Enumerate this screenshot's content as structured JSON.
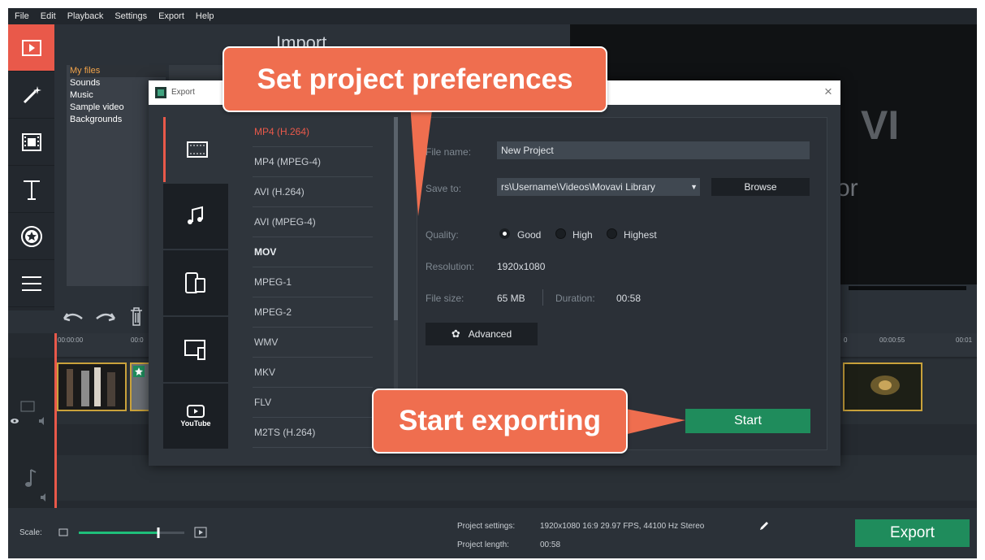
{
  "menu": [
    "File",
    "Edit",
    "Playback",
    "Settings",
    "Export",
    "Help"
  ],
  "import": {
    "title": "Import",
    "categories": [
      "My files",
      "Sounds",
      "Music",
      "Sample video",
      "Backgrounds"
    ],
    "selected": "My files"
  },
  "rail_icons": [
    "import-icon",
    "magic-wand-icon",
    "film-icon",
    "text-icon",
    "sticker-icon",
    "menu-icon"
  ],
  "timeline": {
    "ruler_labels": [
      "00:00:00",
      "00:0",
      "0",
      "00:00:55",
      "00:01"
    ]
  },
  "bottom": {
    "scale_label": "Scale:",
    "scale_value": 0.75,
    "project_settings_label": "Project settings:",
    "project_settings_value": "1920x1080 16:9 29.97 FPS, 44100 Hz Stereo",
    "project_length_label": "Project length:",
    "project_length_value": "00:58",
    "export_label": "Export"
  },
  "dialog": {
    "title": "Export",
    "close": "×",
    "tab_youtube_label": "YouTube",
    "formats": [
      "MP4 (H.264)",
      "MP4 (MPEG-4)",
      "AVI (H.264)",
      "AVI (MPEG-4)",
      "MOV",
      "MPEG-1",
      "MPEG-2",
      "WMV",
      "MKV",
      "FLV",
      "M2TS (H.264)"
    ],
    "selected_format": "MP4 (H.264)",
    "file_name_label": "File name:",
    "file_name_value": "New Project",
    "save_to_label": "Save to:",
    "save_to_value": "rs\\Username\\Videos\\Movavi Library",
    "browse_label": "Browse",
    "quality_label": "Quality:",
    "quality_options": [
      "Good",
      "High",
      "Highest"
    ],
    "quality_selected": "Good",
    "resolution_label": "Resolution:",
    "resolution_value": "1920x1080",
    "file_size_label": "File size:",
    "file_size_value": "65 MB",
    "duration_label": "Duration:",
    "duration_value": "00:58",
    "advanced_label": "Advanced",
    "start_label": "Start"
  },
  "callouts": {
    "top": "Set project preferences",
    "bottom": "Start exporting"
  },
  "colors": {
    "accent": "#e9594a",
    "callout": "#ef6e4f",
    "start_green": "#1f8c5c"
  }
}
